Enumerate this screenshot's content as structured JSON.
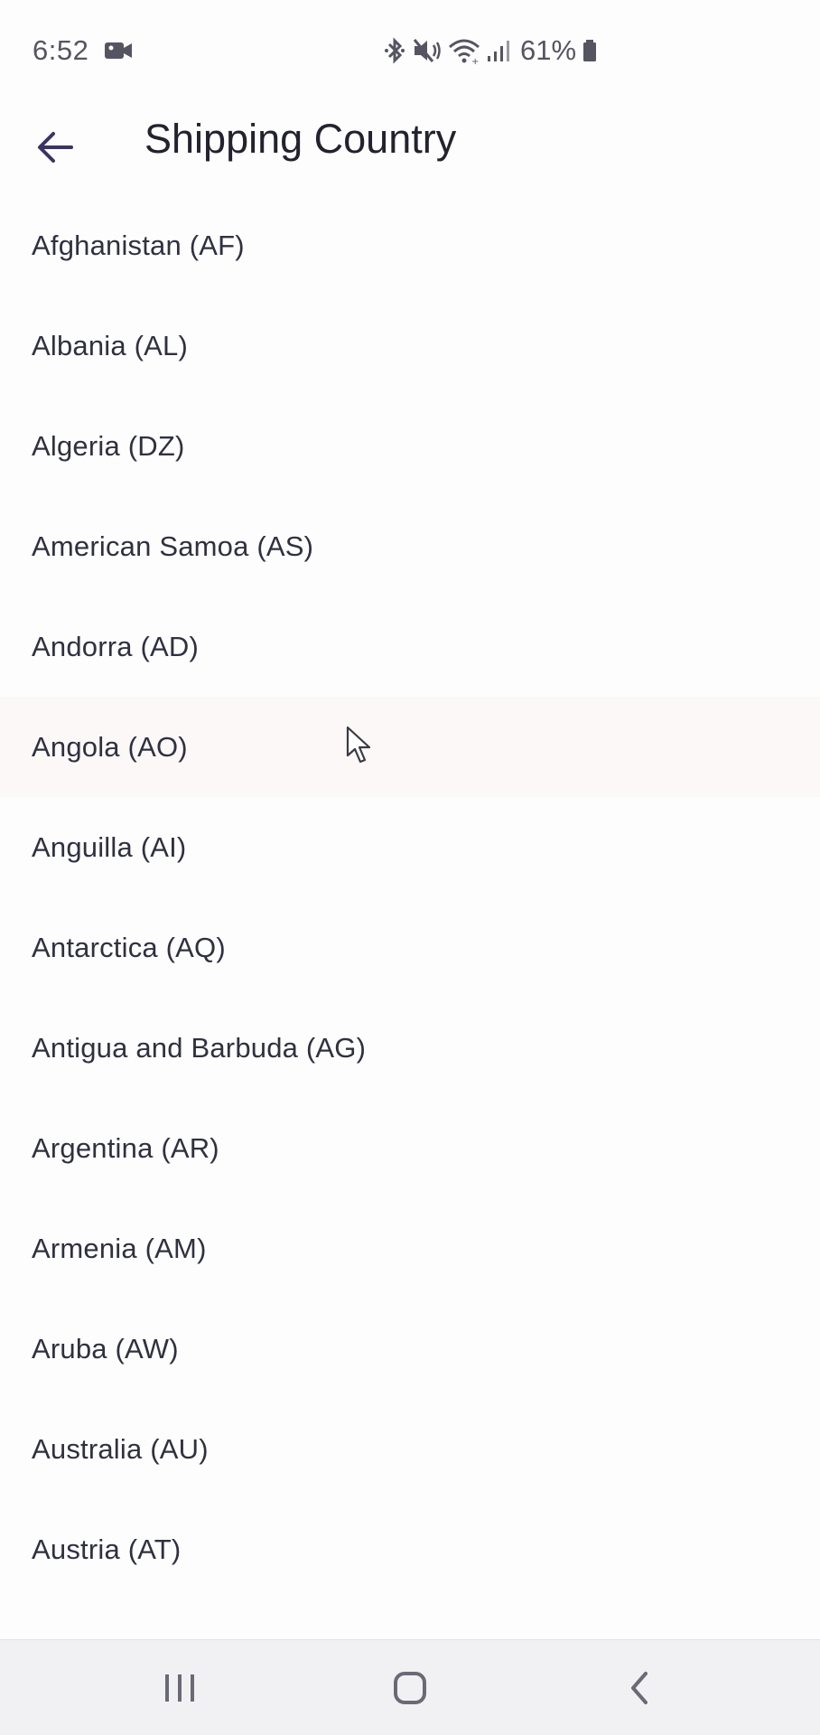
{
  "status_bar": {
    "time": "6:52",
    "battery": "61%",
    "icons": [
      "video-camera-icon",
      "bluetooth-icon",
      "mute-icon",
      "wifi-icon",
      "signal-icon",
      "battery-icon"
    ]
  },
  "app_bar": {
    "title": "Shipping Country",
    "back_icon": "arrow-left-icon"
  },
  "countries": [
    "Afghanistan (AF)",
    "Albania (AL)",
    "Algeria (DZ)",
    "American Samoa (AS)",
    "Andorra (AD)",
    "Angola (AO)",
    "Anguilla (AI)",
    "Antarctica (AQ)",
    "Antigua and Barbuda (AG)",
    "Argentina (AR)",
    "Armenia (AM)",
    "Aruba (AW)",
    "Australia (AU)",
    "Austria (AT)"
  ],
  "highlighted_country": "Angola (AO)",
  "nav_bar": {
    "icons": [
      "recent-apps-icon",
      "home-icon",
      "back-nav-icon"
    ]
  },
  "colors": {
    "accent": "#3b3366",
    "highlight_row": "#fbf8f7",
    "nav_background": "#f1f1f3"
  }
}
